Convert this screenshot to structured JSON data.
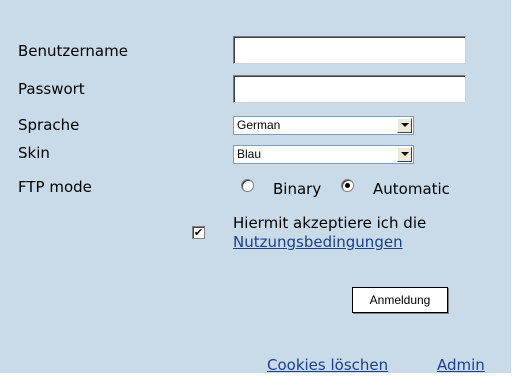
{
  "form": {
    "username_label": "Benutzername",
    "password_label": "Passwort",
    "language_label": "Sprache",
    "language_value": "German",
    "skin_label": "Skin",
    "skin_value": "Blau",
    "ftp_mode_label": "FTP mode",
    "ftp_options": [
      {
        "label": "Binary",
        "selected": false
      },
      {
        "label": "Automatic",
        "selected": true
      }
    ],
    "terms_text": "Hiermit akzeptiere ich die",
    "terms_link": "Nutzungsbedingungen",
    "terms_checked": true,
    "login_button": "Anmeldung"
  },
  "footer": {
    "cookies_link": "Cookies löschen",
    "admin_link": "Admin"
  },
  "colors": {
    "panel_background": "#c9dbe8",
    "link": "#1a3f8f"
  }
}
